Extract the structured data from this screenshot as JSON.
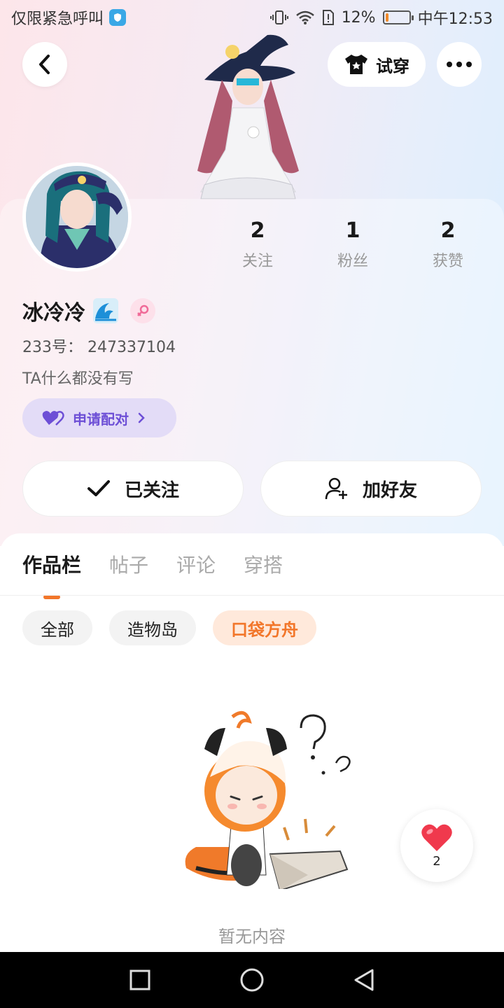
{
  "status": {
    "carrier_text": "仅限紧急呼叫",
    "battery_percent": "12%",
    "battery_level": 0.12,
    "time": "中午12:53"
  },
  "header": {
    "tryon_label": "试穿"
  },
  "profile": {
    "username": "冰冷冷",
    "uid": "233号： 247337104",
    "bio": "TA什么都没有写",
    "pair_label": "申请配对",
    "stats": [
      {
        "value": "2",
        "label": "关注"
      },
      {
        "value": "1",
        "label": "粉丝"
      },
      {
        "value": "2",
        "label": "获赞"
      }
    ]
  },
  "actions": {
    "follow_label": "已关注",
    "add_friend_label": "加好友"
  },
  "tabs": [
    "作品栏",
    "帖子",
    "评论",
    "穿搭"
  ],
  "chips": [
    "全部",
    "造物岛",
    "口袋方舟"
  ],
  "empty": {
    "text": "暂无内容"
  },
  "like_fab": {
    "count": "2"
  },
  "colors": {
    "accent_orange": "#f2762a",
    "pair_purple": "#6d4fd6",
    "heart_red": "#f0394d"
  }
}
